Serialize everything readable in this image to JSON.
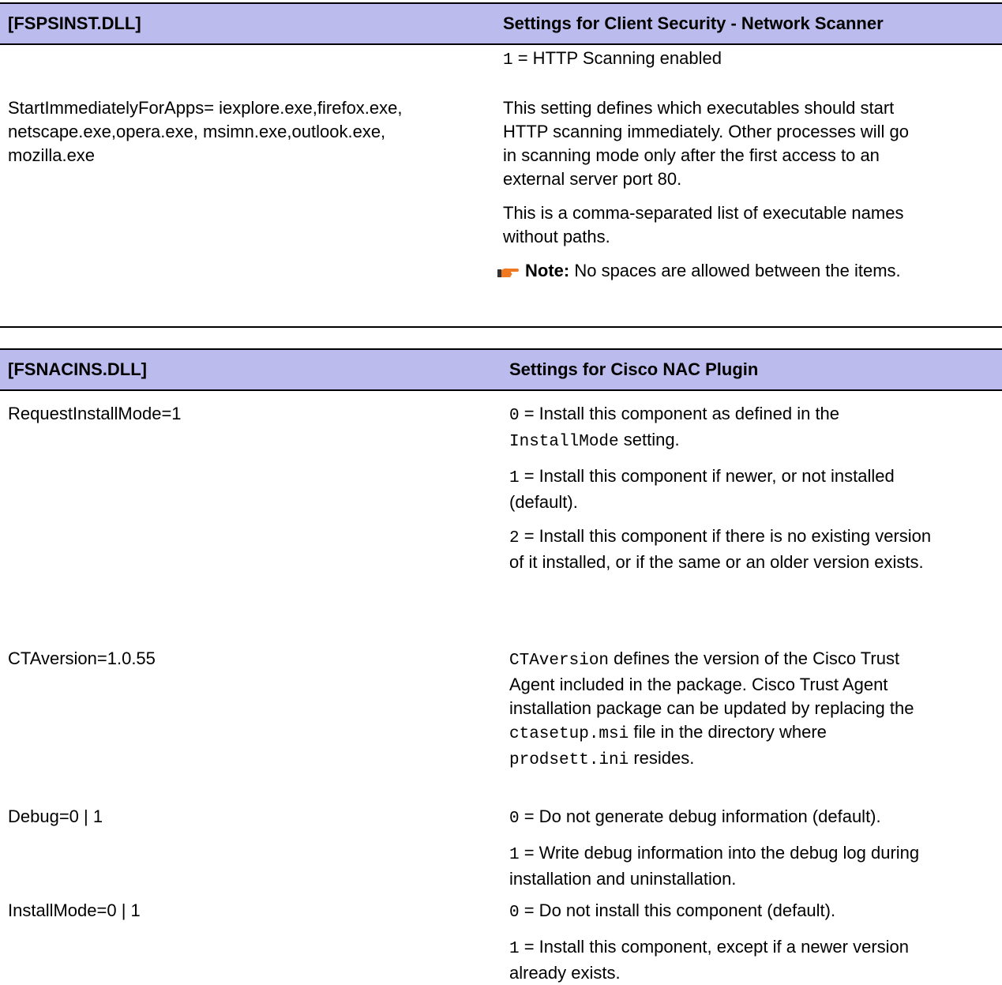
{
  "table1": {
    "header_left": "[FSPSINST.DLL]",
    "header_right": "Settings for Client Security - Network Scanner",
    "row0": {
      "value_code": "1",
      "value_text": " = HTTP Scanning enabled"
    },
    "row1": {
      "key_line1": "StartImmediatelyForApps= iexplore.exe,firefox.exe,",
      "key_line2": "netscape.exe,opera.exe, msimn.exe,outlook.exe,",
      "key_line3": "mozilla.exe",
      "desc1_line1": "This setting defines which executables should start",
      "desc1_line2": "HTTP scanning immediately. Other processes will go",
      "desc1_line3": "in scanning mode only after the first access to an",
      "desc1_line4": "external server port 80.",
      "desc2_line1": "This is a comma-separated list of executable names",
      "desc2_line2": "without paths.",
      "note_label": "Note:",
      "note_text": " No spaces are allowed between the items."
    }
  },
  "table2": {
    "header_left": "[FSNACINS.DLL]",
    "header_right": "Settings for Cisco NAC Plugin",
    "rows": [
      {
        "key": "RequestInstallMode=1",
        "p1_code": "0",
        "p1_line1": " = Install this component as defined in the",
        "p1_code2": "InstallMode",
        "p1_line2": " setting.",
        "p2_code": "1",
        "p2_line1": " = Install this component if newer, or not installed",
        "p2_line2": "(default).",
        "p3_code": "2",
        "p3_line1": " = Install this component if there is no existing version",
        "p3_line2": "of it installed, or if the same or an older version exists."
      },
      {
        "key": "CTAversion=1.0.55",
        "code1": "CTAversion",
        "line1": " defines the version of the Cisco Trust",
        "line2": "Agent included in the package. Cisco Trust Agent",
        "line3": "installation package can be updated by replacing the",
        "code2": "ctasetup.msi",
        "line4": " file in the directory where",
        "code3": "prodsett.ini",
        "line5": " resides."
      },
      {
        "key": "Debug=0 | 1",
        "p1_code": "0",
        "p1_line1": " = Do not generate debug information (default).",
        "p2_code": "1",
        "p2_line1": " = Write debug information into the debug log during",
        "p2_line2": "installation and uninstallation."
      },
      {
        "key": "InstallMode=0 | 1",
        "p1_code": "0",
        "p1_line1": " = Do not install this component (default).",
        "p2_code": "1",
        "p2_line1": " = Install this component, except if a newer version",
        "p2_line2": "already exists."
      }
    ]
  },
  "colors": {
    "header_bg": "#bbbbee",
    "rule": "#000000",
    "note_icon_orange": "#f07820",
    "note_icon_dark": "#333333"
  },
  "icons": [
    "note-hand-pointer-icon"
  ]
}
